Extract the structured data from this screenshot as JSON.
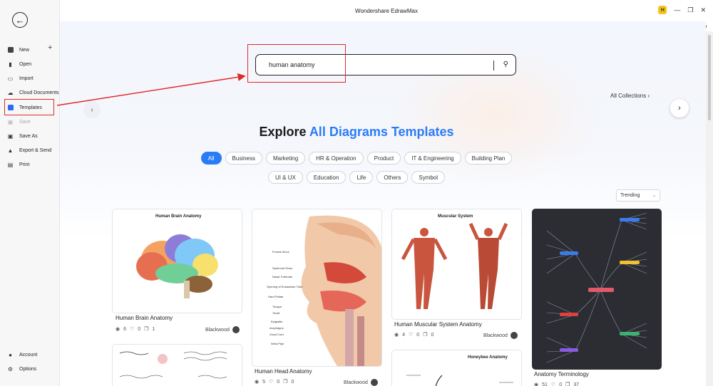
{
  "app": {
    "title": "Wondershare EdrawMax",
    "avatar_initial": "H"
  },
  "sidebar": {
    "items": [
      {
        "label": "New",
        "icon": "new-icon"
      },
      {
        "label": "Open",
        "icon": "folder-icon"
      },
      {
        "label": "Import",
        "icon": "import-icon"
      },
      {
        "label": "Cloud Documents",
        "icon": "cloud-icon"
      },
      {
        "label": "Templates",
        "icon": "templates-icon"
      },
      {
        "label": "Save",
        "icon": "save-icon"
      },
      {
        "label": "Save As",
        "icon": "save-as-icon"
      },
      {
        "label": "Export & Send",
        "icon": "export-icon"
      },
      {
        "label": "Print",
        "icon": "print-icon"
      },
      {
        "label": "Account",
        "icon": "account-icon"
      },
      {
        "label": "Options",
        "icon": "gear-icon"
      }
    ]
  },
  "search": {
    "value": "human anatomy"
  },
  "collections": {
    "label": "All Collections"
  },
  "heading": {
    "prefix": "Explore",
    "accent": "All Diagrams Templates"
  },
  "categories_row1": [
    "All",
    "Business",
    "Marketing",
    "HR & Operation",
    "Product",
    "IT & Engineering",
    "Building Plan"
  ],
  "categories_row2": [
    "UI & UX",
    "Education",
    "Life",
    "Others",
    "Symbol"
  ],
  "sort": {
    "value": "Trending"
  },
  "cards": [
    {
      "title": "Human Brain Anatomy",
      "views": "6",
      "likes": "0",
      "copies": "1",
      "author": "Blackwood",
      "thumb_title": "Human Brain Anatomy"
    },
    {
      "title": "Human Head Anatomy",
      "views": "5",
      "likes": "0",
      "copies": "0",
      "author": "Blackwood"
    },
    {
      "title": "Human Muscular System Anatomy",
      "views": "4",
      "likes": "0",
      "copies": "0",
      "author": "Blackwood",
      "thumb_title": "Muscular System"
    },
    {
      "title": "Anatomy Terminology",
      "views": "51",
      "likes": "0",
      "copies": "37",
      "author": ""
    },
    {
      "thumb_title": "Honeybee Anatomy"
    }
  ],
  "head_labels": [
    "Frontal Sinus",
    "Sphenoid Sinus",
    "Nasal Turbinate",
    "Opening of Eustachian Tube",
    "Hard Palate",
    "Tongue",
    "Tonsil",
    "Epiglottis",
    "esophagus",
    "Vocal Cord",
    "Wind Pipe"
  ],
  "colors": {
    "accent": "#2a7cf6",
    "highlight": "#e02a2a"
  }
}
